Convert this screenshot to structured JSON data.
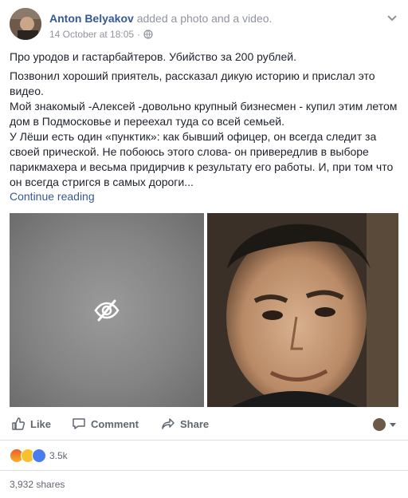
{
  "post": {
    "author": "Anton Belyakov",
    "action_prefix": "added",
    "action_object": "a photo and a video.",
    "timestamp": "14 October at 18:05",
    "privacy_icon": "globe-icon",
    "paragraph_1": "Про уродов и гастарбайтеров. Убийство за 200 рублей.",
    "paragraph_2": "Позвонил хороший приятель, рассказал дикую историю и прислал это видео.\nМой знакомый -Алексей -довольно крупный бизнесмен - купил этим летом дом в Подмосковье и переехал туда со всей семьей.\nУ Лёши есть один «пунктик»: как бывший офицер, он всегда следит за своей прической. Не побоюсь этого слова- он привередлив в выборе парикмахера и весьма придирчив к результату его работы. И, при том что он всегда стригся в самых дороги...",
    "continue_label": "Continue reading"
  },
  "actions": {
    "like": "Like",
    "comment": "Comment",
    "share": "Share"
  },
  "reactions": {
    "count": "3.5k",
    "types": [
      "angry",
      "sad",
      "like"
    ]
  },
  "shares": "3,932 shares"
}
